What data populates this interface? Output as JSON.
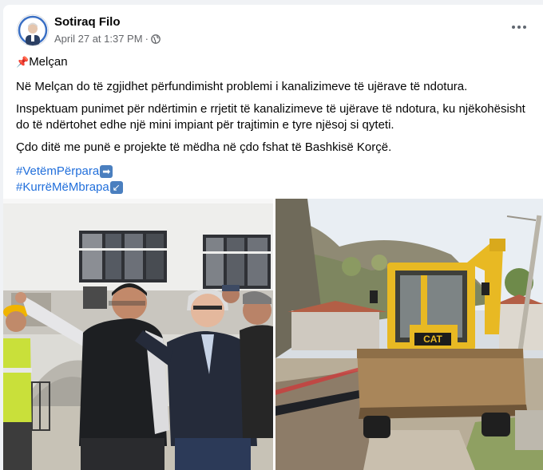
{
  "post": {
    "author": "Sotiraq Filo",
    "timestamp": "April 27 at 1:37 PM",
    "separator": "·",
    "audience_icon": "globe-icon",
    "more_icon": "ellipsis-icon",
    "location_pin": "📌",
    "location": "Melçan",
    "paragraphs": [
      "Në Melçan do të zgjidhet përfundimisht problemi i kanalizimeve të ujërave të ndotura.",
      "Inspektuam punimet për ndërtimin e rrjetit të kanalizimeve të ujërave të ndotura, ku njëkohësisht do të ndërtohet edhe një mini impiant për trajtimin e tyre njësoj si qyteti.",
      "Çdo ditë me punë e projekte të mëdha në çdo fshat të Bashkisë Korçë."
    ],
    "hashtags": [
      {
        "text": "#VetëmPërpara",
        "emoji": "➡"
      },
      {
        "text": "#KurrëMëMbrapa",
        "emoji": "↙"
      }
    ]
  },
  "photos": {
    "left": {
      "machine_label": ""
    },
    "right": {
      "machine_label": "CAT"
    }
  },
  "colors": {
    "link": "#216fdb",
    "meta": "#65676b",
    "text": "#050505",
    "background": "#f0f2f5",
    "excavator": "#e8b923"
  }
}
